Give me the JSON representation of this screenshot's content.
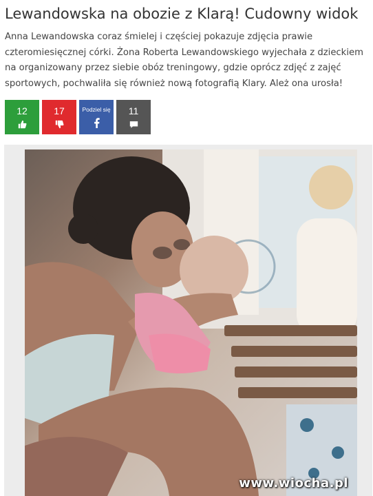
{
  "article": {
    "title": "Lewandowska na obozie z Klarą! Cudowny widok",
    "lead": "Anna Lewandowska coraz śmielej i częściej pokazuje zdjęcia prawie czteromiesięcznej córki. Żona Roberta Lewandowskiego wyjechała z dzieckiem na organizowany przez siebie obóz treningowy, gdzie oprócz zdjęć z zajęć sportowych, pochwaliła się również nową fotografią Klary. Ależ ona urosła!"
  },
  "actions": {
    "likes": "12",
    "dislikes": "17",
    "share_label": "Podziel się",
    "comments": "11",
    "colors": {
      "like": "#2d9e3b",
      "dislike": "#e02a2e",
      "share": "#3b5ea8",
      "comment": "#555555"
    },
    "icons": {
      "like": "thumbs-up-icon",
      "dislike": "thumbs-down-icon",
      "share": "facebook-icon",
      "comment": "comment-icon"
    }
  },
  "image": {
    "watermark": "www.wiocha.pl"
  }
}
